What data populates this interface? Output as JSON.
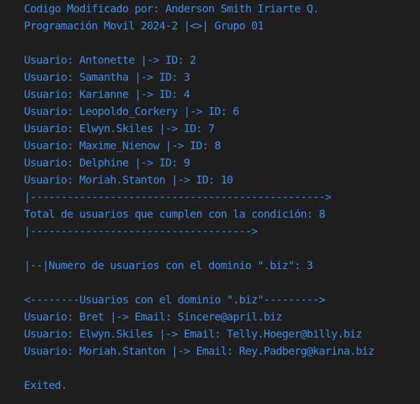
{
  "console": {
    "lines": [
      "Codigo Modificado por: Anderson Smith Iriarte Q.",
      "Programación Movil 2024-2 |<>| Grupo 01",
      "",
      "Usuario: Antonette |-> ID: 2",
      "Usuario: Samantha |-> ID: 3",
      "Usuario: Karianne |-> ID: 4",
      "Usuario: Leopoldo_Corkery |-> ID: 6",
      "Usuario: Elwyn.Skiles |-> ID: 7",
      "Usuario: Maxime_Nienow |-> ID: 8",
      "Usuario: Delphine |-> ID: 9",
      "Usuario: Moriah.Stanton |-> ID: 10",
      "|------------------------------------------------>",
      "Total de usuarios que cumplen con la condición: 8",
      "|------------------------------------>",
      "",
      "|--|Numero de usuarios con el dominio \".biz\": 3",
      "",
      "<--------Usuarios con el dominio \".biz\"--------->",
      "Usuario: Bret |-> Email: Sincere@april.biz",
      "Usuario: Elwyn.Skiles |-> Email: Telly.Hoeger@billy.biz",
      "Usuario: Moriah.Stanton |-> Email: Rey.Padberg@karina.biz",
      "",
      "Exited."
    ]
  },
  "colors": {
    "background": "#1e1e1e",
    "text": "#3b8eea"
  }
}
